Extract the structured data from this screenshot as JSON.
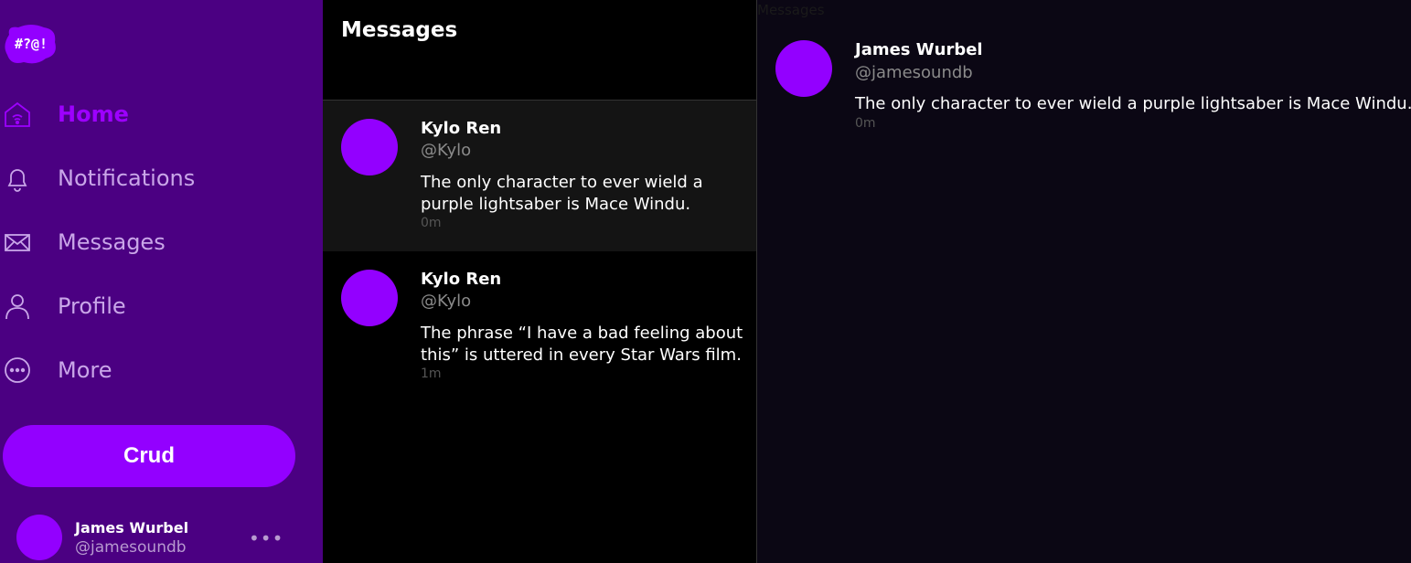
{
  "app": {
    "logo_text": "#?@!",
    "accent": "#9300ff",
    "sidebar_bg": "#4b0082"
  },
  "sidebar": {
    "items": [
      {
        "label": "Home",
        "icon": "home-icon",
        "active": true
      },
      {
        "label": "Notifications",
        "icon": "bell-icon",
        "active": false
      },
      {
        "label": "Messages",
        "icon": "envelope-icon",
        "active": false
      },
      {
        "label": "Profile",
        "icon": "user-icon",
        "active": false
      },
      {
        "label": "More",
        "icon": "more-circle-icon",
        "active": false
      }
    ],
    "compose_label": "Crud",
    "account": {
      "name": "James Wurbel",
      "handle": "@jamesoundb",
      "menu": "•••"
    }
  },
  "messages": {
    "title": "Messages",
    "items": [
      {
        "name": "Kylo Ren",
        "handle": "@Kylo",
        "text": "The only character to ever wield a purple lightsaber is Mace Windu.",
        "time": "0m",
        "selected": true
      },
      {
        "name": "Kylo Ren",
        "handle": "@Kylo",
        "text": "The phrase “I have a bad feeling about this” is uttered in every Star Wars film.",
        "time": "1m",
        "selected": false
      }
    ]
  },
  "detail": {
    "ghost_title": "Messages",
    "name": "James Wurbel",
    "handle": "@jamesoundb",
    "text": "The only character to ever wield a purple lightsaber is Mace Windu.",
    "time": "0m"
  }
}
